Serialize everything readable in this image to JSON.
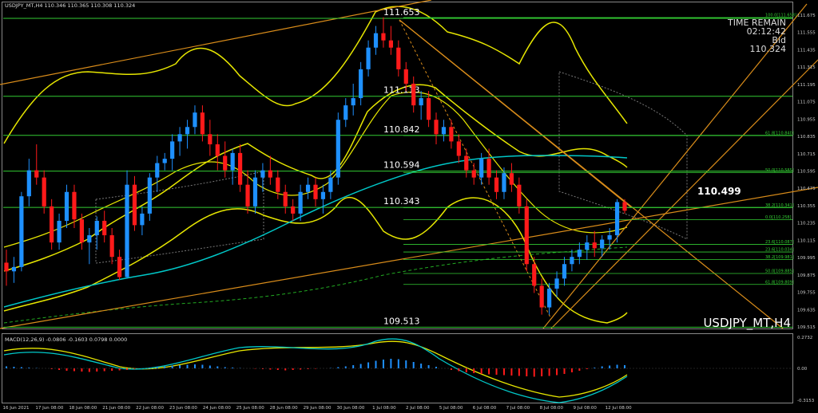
{
  "window": {
    "header_text": "USDJPY_MT,H4  110.346 110.365 110.308 110.324",
    "symbol_watermark": "USDJPY_MT,H4",
    "time_remain_label": "TIME REMAIN",
    "time_remain_value": "02:12:42",
    "bid_label": "Bid",
    "bid_value": "110.324",
    "current_level_label": "110.499"
  },
  "colors": {
    "background": "#000000",
    "bull_candle": "#1e90ff",
    "bear_candle": "#ff1a1a",
    "bollinger": "#e6e600",
    "level_line": "#33cc33",
    "trend_line": "#d98c1a",
    "moving_average": "#00c8c8",
    "macd_signal": "#e6e600",
    "macd_main": "#00c8c8"
  },
  "price_axis": {
    "ticks": [
      "111.675",
      "111.555",
      "111.435",
      "111.315",
      "111.195",
      "111.075",
      "110.955",
      "110.835",
      "110.715",
      "110.595",
      "110.475",
      "110.355",
      "110.235",
      "110.115",
      "109.995",
      "109.875",
      "109.755",
      "109.635",
      "109.515"
    ]
  },
  "price_tags": [
    "111.653",
    "111.113",
    "110.842",
    "110.594",
    "110.343",
    "109.513"
  ],
  "fib_tags": [
    {
      "text": "100.0[111.658]",
      "price": 111.658
    },
    {
      "text": "61.8[110.840]",
      "price": 110.84
    },
    {
      "text": "50.0[110.585]",
      "price": 110.585
    },
    {
      "text": "38.2[110.341]",
      "price": 110.341
    },
    {
      "text": "0.0[110.258]",
      "price": 110.258
    },
    {
      "text": "23.6[110.087]",
      "price": 110.087
    },
    {
      "text": "23.6[110.034]",
      "price": 110.034
    },
    {
      "text": "38.2[109.981]",
      "price": 109.981
    },
    {
      "text": "50.0[109.885]",
      "price": 109.885
    },
    {
      "text": "61.8[109.809]",
      "price": 109.809
    }
  ],
  "time_axis": {
    "labels": [
      "16 Jun 2021",
      "17 Jun 08:00",
      "18 Jun 08:00",
      "21 Jun 08:00",
      "22 Jun 08:00",
      "23 Jun 08:00",
      "24 Jun 08:00",
      "25 Jun 08:00",
      "28 Jun 08:00",
      "29 Jun 08:00",
      "30 Jun 08:00",
      "1 Jul 08:00",
      "2 Jul 08:00",
      "5 Jul 08:00",
      "6 Jul 08:00",
      "7 Jul 08:00",
      "8 Jul 08:00",
      "9 Jul 08:00",
      "12 Jul 08:00"
    ]
  },
  "macd": {
    "label": "MACD(12,26,9) -0.0806 -0.1603 0.0798 0.0000",
    "ticks": [
      "0.2732",
      "0.00",
      "-0.3153"
    ]
  },
  "chart_data": {
    "type": "candlestick",
    "title": "USDJPY_MT,H4",
    "ylim": [
      109.49,
      111.72
    ],
    "candles": [
      [
        109.96,
        110.05,
        109.8,
        109.9
      ],
      [
        109.9,
        110,
        109.82,
        109.93
      ],
      [
        109.93,
        110.45,
        109.9,
        110.42
      ],
      [
        110.42,
        110.68,
        110.35,
        110.6
      ],
      [
        110.6,
        110.78,
        110.5,
        110.55
      ],
      [
        110.55,
        110.6,
        110.3,
        110.35
      ],
      [
        110.35,
        110.4,
        110.05,
        110.1
      ],
      [
        110.1,
        110.3,
        110.05,
        110.25
      ],
      [
        110.25,
        110.5,
        110.2,
        110.45
      ],
      [
        110.45,
        110.5,
        110.2,
        110.26
      ],
      [
        110.26,
        110.3,
        110.05,
        110.1
      ],
      [
        110.1,
        110.2,
        109.95,
        110.15
      ],
      [
        110.15,
        110.28,
        110.05,
        110.25
      ],
      [
        110.25,
        110.32,
        110.1,
        110.15
      ],
      [
        110.15,
        110.2,
        109.95,
        110
      ],
      [
        110,
        110.05,
        109.84,
        109.86
      ],
      [
        109.86,
        110.6,
        109.85,
        110.5
      ],
      [
        110.5,
        110.56,
        110.18,
        110.22
      ],
      [
        110.22,
        110.35,
        110.15,
        110.3
      ],
      [
        110.3,
        110.58,
        110.25,
        110.55
      ],
      [
        110.55,
        110.7,
        110.45,
        110.65
      ],
      [
        110.65,
        110.72,
        110.6,
        110.68
      ],
      [
        110.68,
        110.85,
        110.6,
        110.8
      ],
      [
        110.8,
        110.9,
        110.7,
        110.85
      ],
      [
        110.85,
        110.95,
        110.75,
        110.9
      ],
      [
        110.9,
        111.05,
        110.85,
        111
      ],
      [
        111,
        111.05,
        110.8,
        110.85
      ],
      [
        110.85,
        110.95,
        110.7,
        110.78
      ],
      [
        110.78,
        110.85,
        110.6,
        110.7
      ],
      [
        110.7,
        110.8,
        110.55,
        110.6
      ],
      [
        110.6,
        110.75,
        110.5,
        110.72
      ],
      [
        110.72,
        110.78,
        110.45,
        110.5
      ],
      [
        110.5,
        110.6,
        110.3,
        110.35
      ],
      [
        110.35,
        110.6,
        110.3,
        110.55
      ],
      [
        110.55,
        110.65,
        110.45,
        110.6
      ],
      [
        110.6,
        110.7,
        110.5,
        110.55
      ],
      [
        110.55,
        110.6,
        110.4,
        110.45
      ],
      [
        110.45,
        110.5,
        110.3,
        110.35
      ],
      [
        110.35,
        110.4,
        110.25,
        110.3
      ],
      [
        110.3,
        110.5,
        110.25,
        110.45
      ],
      [
        110.45,
        110.55,
        110.4,
        110.5
      ],
      [
        110.5,
        110.55,
        110.35,
        110.4
      ],
      [
        110.4,
        110.5,
        110.3,
        110.45
      ],
      [
        110.45,
        110.6,
        110.4,
        110.55
      ],
      [
        110.55,
        111,
        110.5,
        110.95
      ],
      [
        110.95,
        111.1,
        110.9,
        111.05
      ],
      [
        111.05,
        111.2,
        110.98,
        111.1
      ],
      [
        111.1,
        111.35,
        111.05,
        111.3
      ],
      [
        111.3,
        111.5,
        111.25,
        111.45
      ],
      [
        111.45,
        111.6,
        111.4,
        111.55
      ],
      [
        111.55,
        111.66,
        111.45,
        111.5
      ],
      [
        111.5,
        111.6,
        111.4,
        111.45
      ],
      [
        111.45,
        111.5,
        111.25,
        111.3
      ],
      [
        111.3,
        111.35,
        111.15,
        111.2
      ],
      [
        111.2,
        111.25,
        111,
        111.05
      ],
      [
        111.05,
        111.15,
        110.95,
        111.1
      ],
      [
        111.1,
        111.15,
        110.9,
        110.95
      ],
      [
        110.95,
        111,
        110.78,
        110.85
      ],
      [
        110.85,
        110.95,
        110.8,
        110.9
      ],
      [
        110.9,
        110.95,
        110.75,
        110.8
      ],
      [
        110.8,
        110.85,
        110.65,
        110.7
      ],
      [
        110.7,
        110.75,
        110.55,
        110.6
      ],
      [
        110.6,
        110.65,
        110.5,
        110.55
      ],
      [
        110.55,
        110.72,
        110.5,
        110.68
      ],
      [
        110.68,
        110.75,
        110.5,
        110.55
      ],
      [
        110.55,
        110.6,
        110.4,
        110.45
      ],
      [
        110.45,
        110.62,
        110.4,
        110.58
      ],
      [
        110.58,
        110.65,
        110.45,
        110.5
      ],
      [
        110.5,
        110.55,
        110.3,
        110.35
      ],
      [
        110.35,
        110.4,
        109.9,
        109.95
      ],
      [
        109.95,
        110,
        109.75,
        109.8
      ],
      [
        109.8,
        109.85,
        109.6,
        109.65
      ],
      [
        109.65,
        109.82,
        109.6,
        109.78
      ],
      [
        109.78,
        109.9,
        109.72,
        109.85
      ],
      [
        109.85,
        110,
        109.8,
        109.95
      ],
      [
        109.95,
        110.05,
        109.9,
        110
      ],
      [
        110,
        110.1,
        109.95,
        110.05
      ],
      [
        110.05,
        110.15,
        109.98,
        110.1
      ],
      [
        110.1,
        110.18,
        110,
        110.06
      ],
      [
        110.06,
        110.15,
        110,
        110.12
      ],
      [
        110.12,
        110.2,
        110.05,
        110.15
      ],
      [
        110.15,
        110.4,
        110.1,
        110.38
      ],
      [
        110.38,
        110.4,
        110.3,
        110.32
      ]
    ],
    "macd_hist": [
      0.05,
      0.04,
      0.03,
      0.02,
      0.01,
      0,
      -0.02,
      -0.04,
      -0.06,
      -0.07,
      -0.08,
      -0.09,
      -0.08,
      -0.07,
      -0.06,
      -0.05,
      -0.04,
      -0.02,
      0,
      0.02,
      0.04,
      0.05,
      0.07,
      0.08,
      0.09,
      0.1,
      0.09,
      0.07,
      0.05,
      0.03,
      0.02,
      0.01,
      0,
      -0.01,
      -0.02,
      -0.03,
      -0.04,
      -0.05,
      -0.04,
      -0.03,
      -0.02,
      -0.01,
      0,
      0.01,
      0.03,
      0.05,
      0.08,
      0.11,
      0.15,
      0.19,
      0.22,
      0.24,
      0.23,
      0.2,
      0.16,
      0.12,
      0.08,
      0.04,
      0,
      -0.04,
      -0.07,
      -0.1,
      -0.12,
      -0.14,
      -0.15,
      -0.16,
      -0.17,
      -0.18,
      -0.19,
      -0.2,
      -0.21,
      -0.2,
      -0.19,
      -0.17,
      -0.14,
      -0.1,
      -0.06,
      -0.02,
      0.02,
      0.05,
      0.07,
      0.09,
      0.08
    ]
  }
}
